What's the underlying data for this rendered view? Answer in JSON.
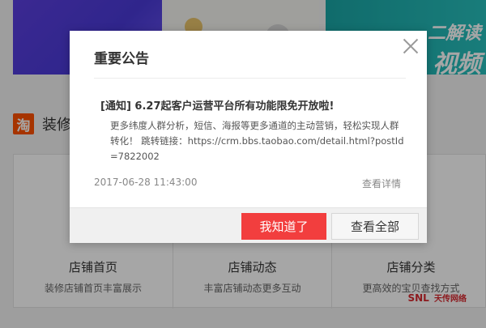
{
  "background": {
    "banner_right_line1": "二解读",
    "banner_right_line2": "视频",
    "section_icon": "淘",
    "section_title": "装修",
    "cards": [
      {
        "title": "店铺首页",
        "desc": "装修店铺首页丰富展示"
      },
      {
        "title": "店铺动态",
        "desc": "丰富店铺动态更多互动"
      },
      {
        "title": "店铺分类",
        "desc": "更高效的宝贝查找方式"
      }
    ],
    "watermark": "SNL",
    "watermark_sub": "天传网络"
  },
  "modal": {
    "title": "重要公告",
    "close_icon": "close-icon",
    "headline": "[通知] 6.27起客户运营平台所有功能限免开放啦!",
    "body": "更多纬度人群分析，短信、海报等更多通道的主动营销，轻松实现人群转化！ 跳转链接：https://crm.bbs.taobao.com/detail.html?postId=7822002",
    "time": "2017-06-28 11:43:00",
    "view_detail": "查看详情",
    "ok_label": "我知道了",
    "view_all_label": "查看全部"
  },
  "colors": {
    "accent": "#f23e3e",
    "taobao_orange": "#ff5000"
  }
}
